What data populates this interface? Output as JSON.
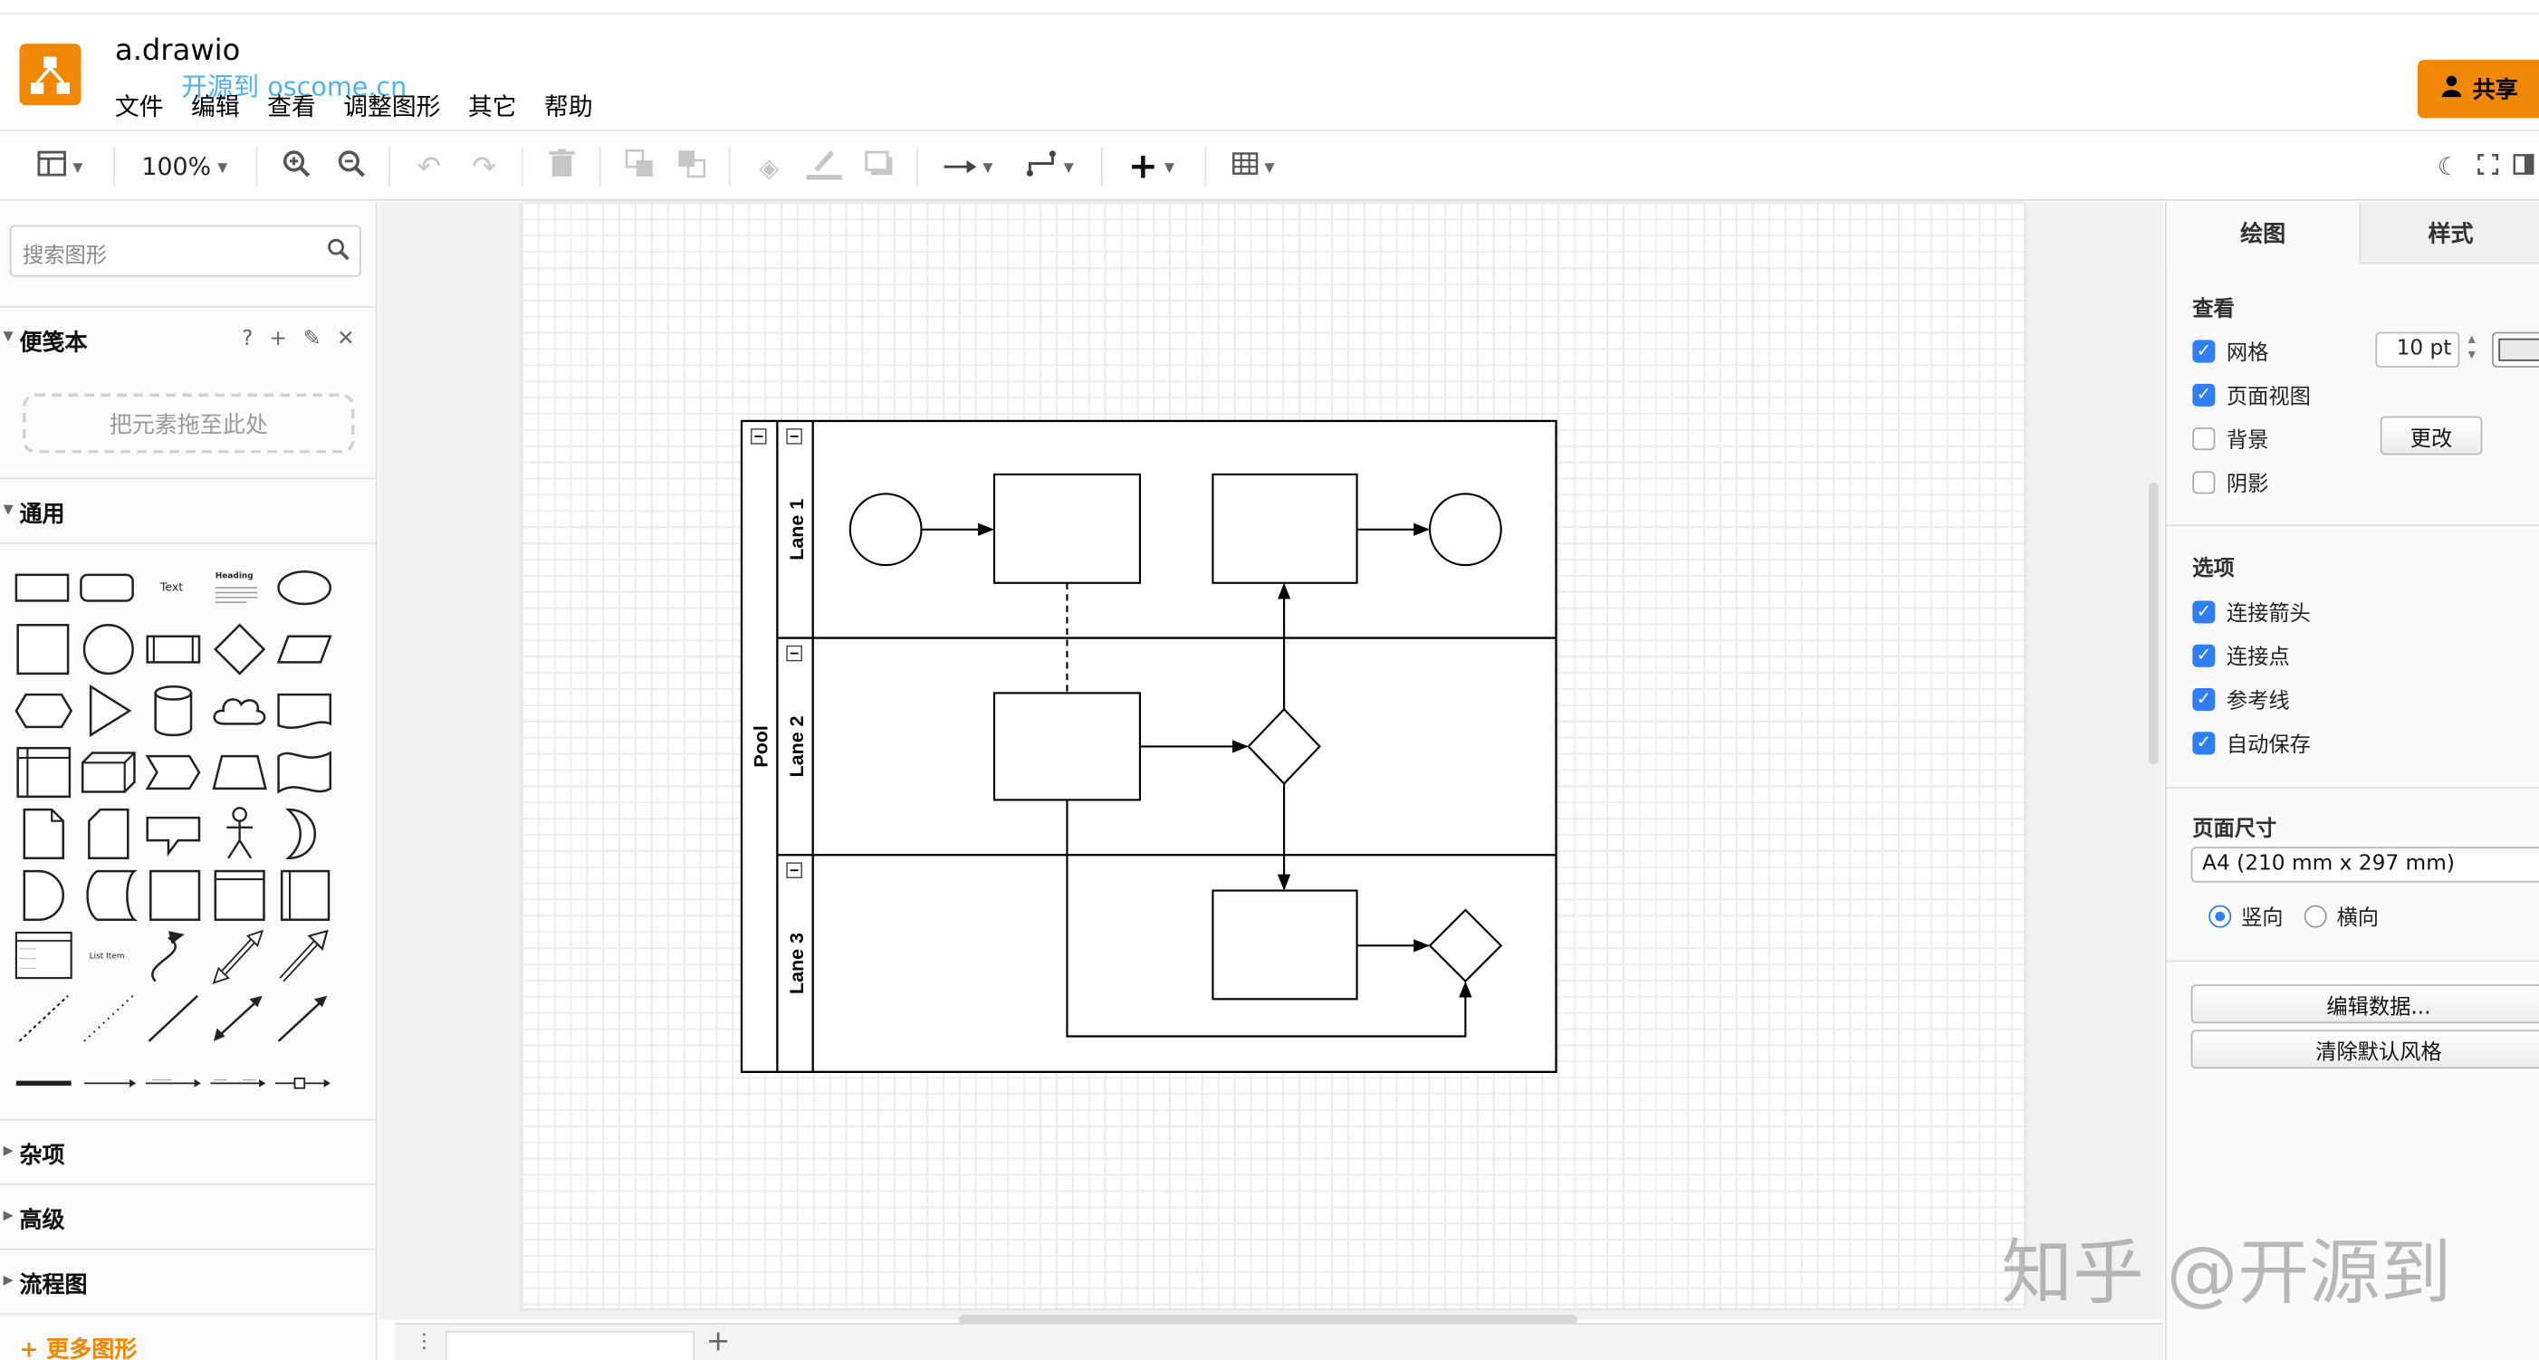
{
  "app": {
    "doc_title": "a.drawio",
    "watermark_link": "开源到 oscome.cn",
    "share_label": "共享",
    "menu": [
      "文件",
      "编辑",
      "查看",
      "调整图形",
      "其它",
      "帮助"
    ]
  },
  "toolbar": {
    "zoom": "100%"
  },
  "left_panel": {
    "search_placeholder": "搜索图形",
    "scratchpad_title": "便笺本",
    "scratchpad_icons": [
      "?",
      "+",
      "✎",
      "✕"
    ],
    "dropzone_text": "把元素拖至此处",
    "general_title": "通用",
    "shape_text_label": "Text",
    "shape_heading_label": "Heading",
    "shape_list_item_label": "List Item",
    "collapsed_sections": [
      "杂项",
      "高级",
      "流程图"
    ],
    "more_shapes": "+ 更多图形"
  },
  "diagram": {
    "pool_label": "Pool",
    "lanes": [
      "Lane 1",
      "Lane 2",
      "Lane 3"
    ]
  },
  "right_panel": {
    "tabs": [
      "绘图",
      "样式"
    ],
    "view_title": "查看",
    "view_options": [
      {
        "label": "网格",
        "checked": true
      },
      {
        "label": "页面视图",
        "checked": true
      },
      {
        "label": "背景",
        "checked": false
      },
      {
        "label": "阴影",
        "checked": false
      }
    ],
    "grid_size": "10 pt",
    "change_button": "更改",
    "options_title": "选项",
    "options": [
      {
        "label": "连接箭头",
        "checked": true
      },
      {
        "label": "连接点",
        "checked": true
      },
      {
        "label": "参考线",
        "checked": true
      },
      {
        "label": "自动保存",
        "checked": true
      }
    ],
    "page_size_title": "页面尺寸",
    "page_size_value": "A4 (210 mm x 297 mm)",
    "orientation_portrait": "竖向",
    "orientation_landscape": "横向",
    "edit_data_button": "编辑数据...",
    "clear_style_button": "清除默认风格"
  },
  "watermark": "知乎 @开源到",
  "colors": {
    "accent": "#f08705",
    "checkbox": "#2f7ef6"
  }
}
